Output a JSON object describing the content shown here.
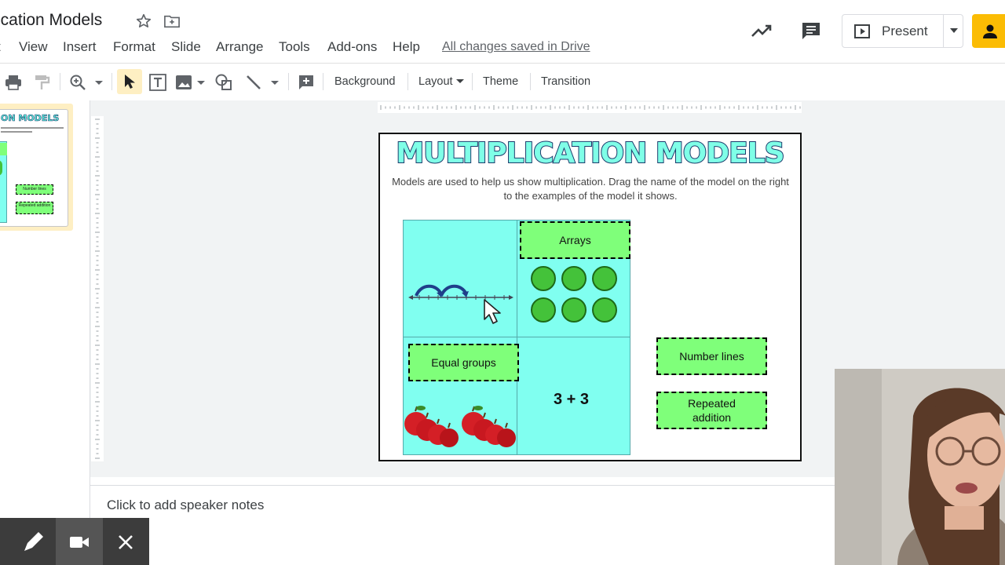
{
  "document": {
    "title": "ication Models",
    "save_status": "All changes saved in Drive"
  },
  "menu": [
    "t",
    "View",
    "Insert",
    "Format",
    "Slide",
    "Arrange",
    "Tools",
    "Add-ons",
    "Help"
  ],
  "header": {
    "present_label": "Present"
  },
  "toolbar": {
    "background_label": "Background",
    "layout_label": "Layout",
    "theme_label": "Theme",
    "transition_label": "Transition"
  },
  "slide": {
    "title": "MULTIPLICATION MODELS",
    "subtitle": "Models are used to help us show multiplication. Drag the name of the model on the right to the examples of the model it shows.",
    "labels": {
      "arrays": "Arrays",
      "equal_groups": "Equal groups",
      "number_lines": "Number lines",
      "repeated_addition_1": "Repeated",
      "repeated_addition_2": "addition"
    },
    "sum_expression": "3 + 3"
  },
  "thumbnail": {
    "title": "ON MODELS",
    "label_a": "Number lines",
    "label_b": "Repeated addition"
  },
  "notes": {
    "placeholder": "Click to add speaker notes"
  },
  "colors": {
    "accent_yellow": "#fbbc04",
    "cell_cyan": "#80fff0",
    "label_green": "#7fff7a",
    "dot_green": "#44c23a"
  }
}
